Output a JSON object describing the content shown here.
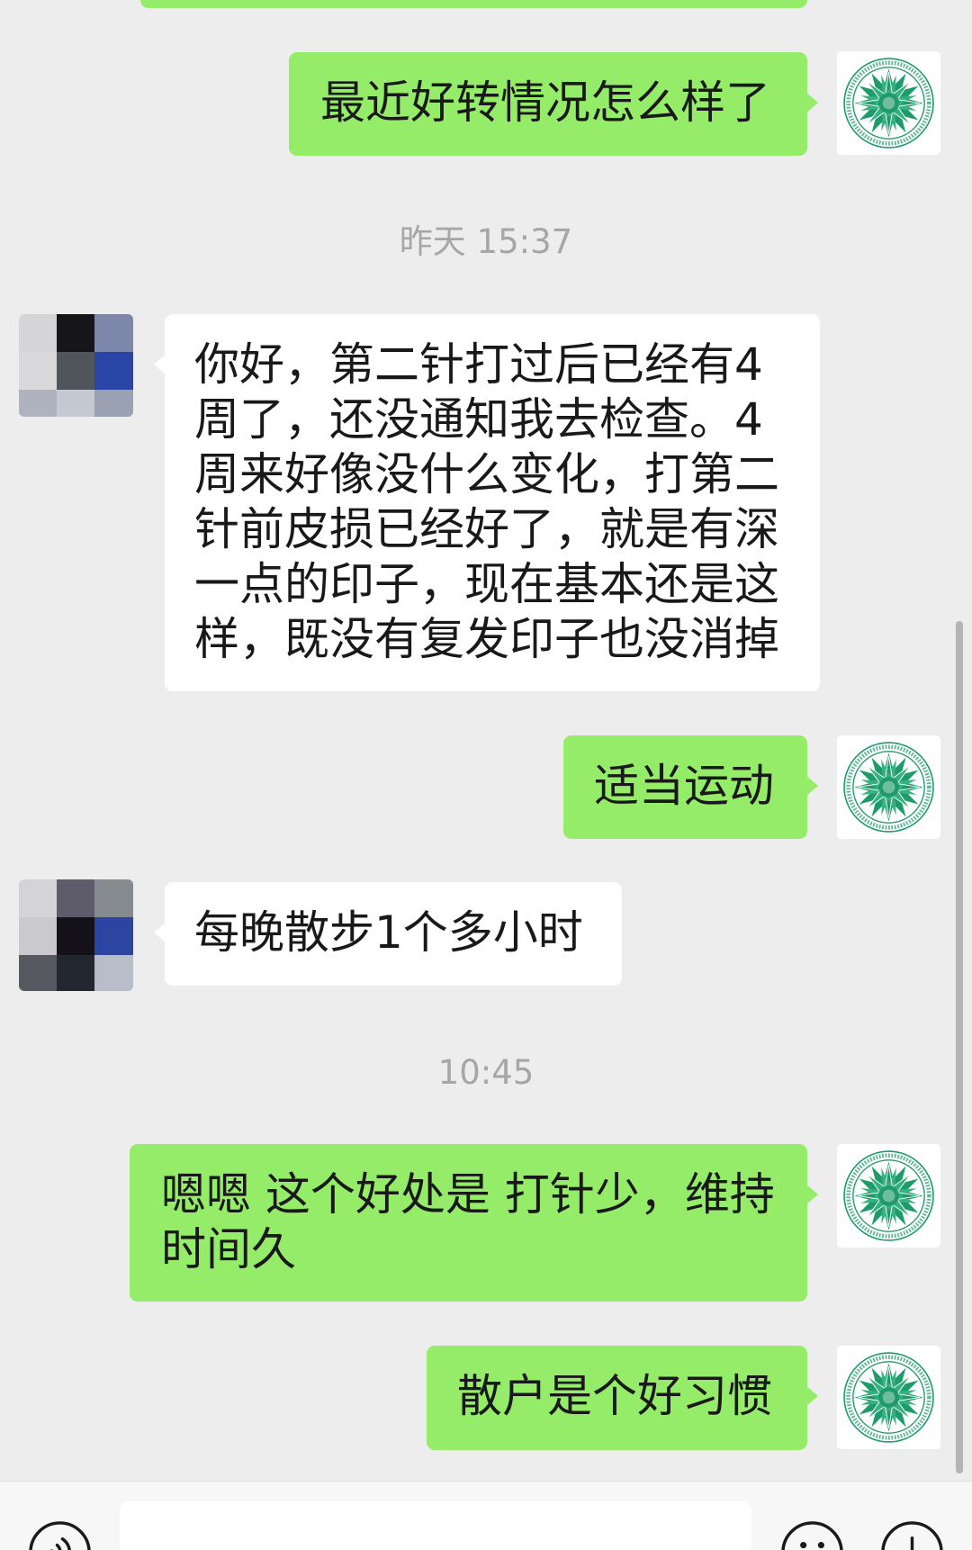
{
  "theme": {
    "chat_background": "#ededed",
    "outgoing_bubble": "#95ec69",
    "incoming_bubble": "#ffffff",
    "message_text": "#191919",
    "timestamp_text": "#a6a6a6",
    "input_bar_background": "#f7f7f7",
    "logo_green": "#1f9a6a",
    "scrollbar": "#b4b4b4"
  },
  "self_avatar": {
    "icon": "green-emblem-logo"
  },
  "contact_avatars": [
    {
      "icon": "pixelated-photo",
      "tiles": [
        "#d5d5d8",
        "#15151a",
        "#7d86ab",
        "#d9d9dc",
        "#50555c",
        "#2946a6",
        "#aeb3bf",
        "#c4c8d0",
        "#9aa1b2"
      ]
    },
    {
      "icon": "pixelated-photo",
      "tiles": [
        "#d4d4d8",
        "#5e5b6b",
        "#868b90",
        "#cacace",
        "#141119",
        "#2b45a1",
        "#56595f",
        "#232830",
        "#b9bdc9"
      ]
    }
  ],
  "messages": [
    {
      "outgoing": true,
      "lines": []
    },
    {
      "outgoing": true,
      "lines": [
        "最近好转情况怎么样了"
      ]
    },
    {
      "outgoing": false,
      "lines": [
        "你好，第二针打过后已经有4",
        "周了，还没通知我去检查。4",
        "周来好像没什么变化，打第二",
        "针前皮损已经好了，就是有深",
        "一点的印子，现在基本还是这",
        "样，既没有复发印子也没消掉"
      ]
    },
    {
      "outgoing": true,
      "lines": [
        "适当运动"
      ]
    },
    {
      "outgoing": false,
      "lines": [
        "每晚散步1个多小时"
      ]
    },
    {
      "outgoing": true,
      "lines": [
        "嗯嗯 这个好处是 打针少，维持",
        "时间久"
      ]
    },
    {
      "outgoing": true,
      "lines": [
        "散户是个好习惯"
      ]
    }
  ],
  "timestamps": [
    "昨天 15:37",
    "10:45"
  ],
  "input_bar": {
    "icons": [
      "voice-icon",
      "emoji-icon",
      "plus-icon"
    ]
  }
}
